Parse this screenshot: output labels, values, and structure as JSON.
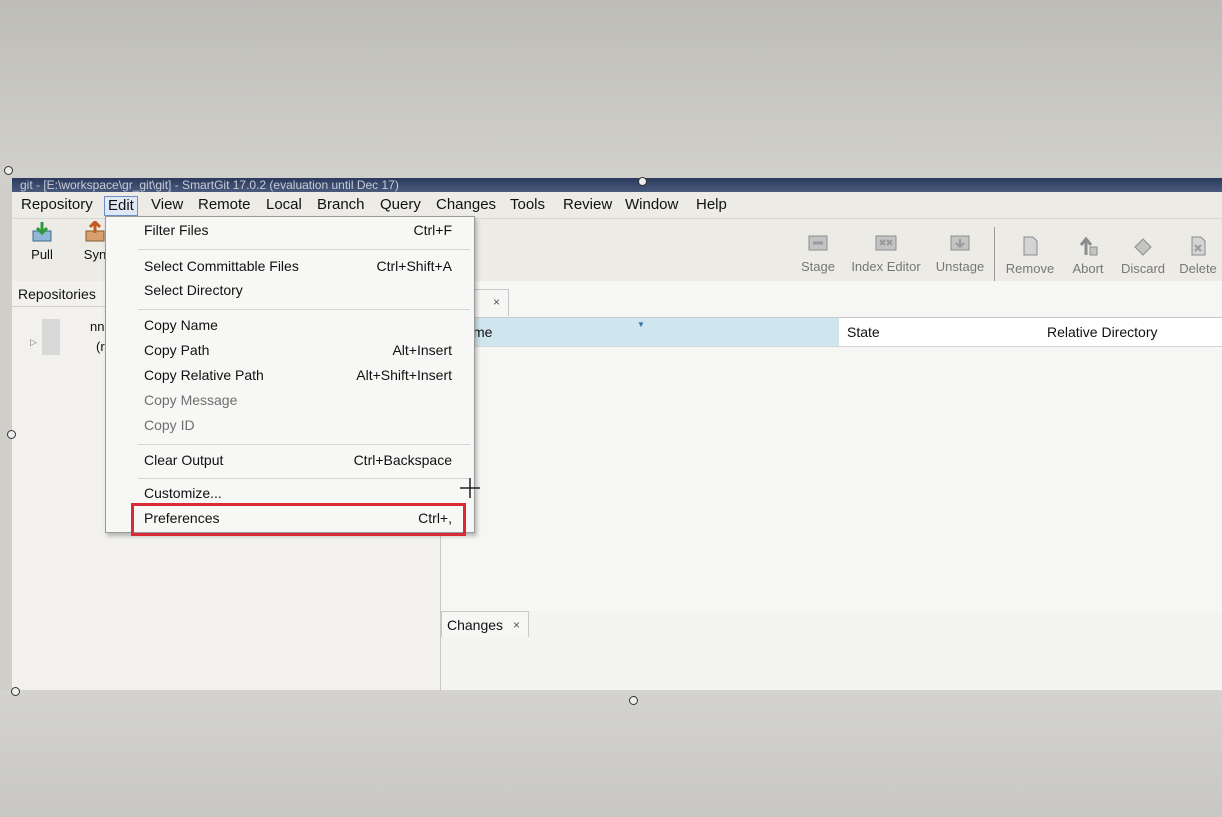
{
  "window": {
    "title": "git - [E:\\workspace\\gr_git\\git] - SmartGit 17.0.2 (evaluation until Dec 17)"
  },
  "menubar": {
    "items": [
      "Repository",
      "Edit",
      "View",
      "Remote",
      "Local",
      "Branch",
      "Query",
      "Changes",
      "Tools",
      "Review",
      "Window",
      "Help"
    ],
    "open_item": "Edit"
  },
  "toolbar": {
    "left": [
      {
        "label": "Pull",
        "icon": "pull-icon"
      },
      {
        "label": "Syn",
        "icon": "sync-icon"
      }
    ],
    "right": [
      {
        "label": "Stage",
        "icon": "stage-icon"
      },
      {
        "label": "Index Editor",
        "icon": "index-editor-icon"
      },
      {
        "label": "Unstage",
        "icon": "unstage-icon"
      },
      {
        "label": "Remove",
        "icon": "remove-icon"
      },
      {
        "label": "Abort",
        "icon": "abort-icon"
      },
      {
        "label": "Discard",
        "icon": "discard-icon"
      },
      {
        "label": "Delete",
        "icon": "delete-icon"
      }
    ]
  },
  "repositories": {
    "header": "Repositories",
    "row_text": "nn",
    "row_sub": "(r"
  },
  "files": {
    "tab_close": "×",
    "columns": {
      "name": "me",
      "state": "State",
      "relative_directory": "Relative Directory"
    }
  },
  "changes": {
    "tab_label": "Changes",
    "tab_close": "×"
  },
  "edit_menu": {
    "items": [
      {
        "label": "Filter Files",
        "shortcut": "Ctrl+F",
        "enabled": true
      },
      {
        "label": "Select Committable Files",
        "shortcut": "Ctrl+Shift+A",
        "enabled": true
      },
      {
        "label": "Select Directory",
        "shortcut": "",
        "enabled": true
      },
      {
        "label": "Copy Name",
        "shortcut": "",
        "enabled": true
      },
      {
        "label": "Copy Path",
        "shortcut": "Alt+Insert",
        "enabled": true
      },
      {
        "label": "Copy Relative Path",
        "shortcut": "Alt+Shift+Insert",
        "enabled": true
      },
      {
        "label": "Copy Message",
        "shortcut": "",
        "enabled": false
      },
      {
        "label": "Copy ID",
        "shortcut": "",
        "enabled": false
      },
      {
        "label": "Clear Output",
        "shortcut": "Ctrl+Backspace",
        "enabled": true
      },
      {
        "label": "Customize...",
        "shortcut": "",
        "enabled": true
      },
      {
        "label": "Preferences",
        "shortcut": "Ctrl+,",
        "enabled": true
      }
    ],
    "highlighted_item": "Preferences",
    "highlight_color": "#d92b35"
  },
  "colors": {
    "selected_column": "#cfe6ee",
    "menu_open_border": "#6d8fc2"
  }
}
